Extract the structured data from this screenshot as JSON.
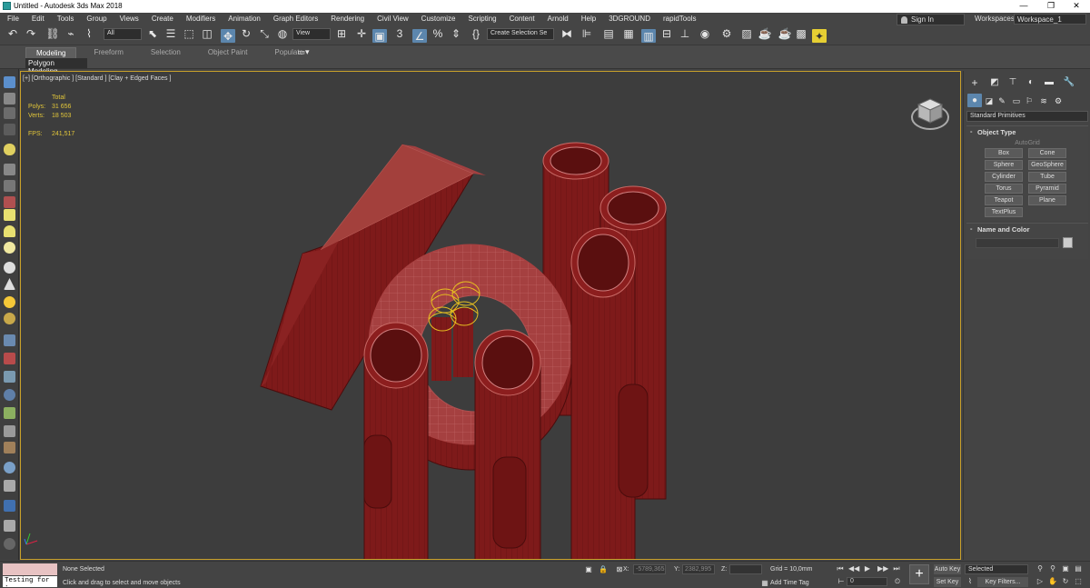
{
  "window": {
    "title": "Untitled - Autodesk 3ds Max 2018",
    "minimize": "—",
    "maximize": "❐",
    "close": "✕"
  },
  "menubar": {
    "items": [
      "File",
      "Edit",
      "Tools",
      "Group",
      "Views",
      "Create",
      "Modifiers",
      "Animation",
      "Graph Editors",
      "Rendering",
      "Civil View",
      "Customize",
      "Scripting",
      "Content",
      "Arnold",
      "Help",
      "3DGROUND",
      "rapidTools"
    ],
    "sign_in": "Sign In",
    "workspaces_label": "Workspaces:",
    "workspace_value": "Workspace_1"
  },
  "toolbar": {
    "selection_filter": "All",
    "ref_coord": "View",
    "named_selection": "Create Selection Se"
  },
  "ribbon": {
    "tabs": [
      "Modeling",
      "Freeform",
      "Selection",
      "Object Paint",
      "Populate"
    ],
    "active_tab": "Modeling",
    "sub_panel": "Polygon Modeling"
  },
  "viewport": {
    "label": "[+] [Orthographic ] [Standard ] [Clay + Edged Faces ]",
    "stats": {
      "header": "Total",
      "polys_label": "Polys:",
      "polys_value": "31 656",
      "verts_label": "Verts:",
      "verts_value": "18 503",
      "fps_label": "FPS:",
      "fps_value": "241,517"
    },
    "colors": {
      "mesh": "#8c1e1e",
      "mesh_light": "#a03a38",
      "wire": "#c86a66",
      "selection": "#e8c020",
      "border": "#c8a02a"
    }
  },
  "command_panel": {
    "category": "Standard Primitives",
    "object_type": {
      "header": "Object Type",
      "autogrid": "AutoGrid",
      "buttons": [
        "Box",
        "Cone",
        "Sphere",
        "GeoSphere",
        "Cylinder",
        "Tube",
        "Torus",
        "Pyramid",
        "Teapot",
        "Plane",
        "TextPlus"
      ]
    },
    "name_color": {
      "header": "Name and Color"
    }
  },
  "statusbar": {
    "script_listener": "Testing for :",
    "selection_status": "None Selected",
    "prompt": "Click and drag to select and move objects",
    "x_label": "X:",
    "x_value": "-5789,365",
    "y_label": "Y:",
    "y_value": "2382,995",
    "z_label": "Z:",
    "z_value": "",
    "grid": "Grid = 10,0mm",
    "add_time_tag": "Add Time Tag",
    "frame": "0",
    "auto_key": "Auto Key",
    "set_key": "Set Key",
    "selected": "Selected",
    "key_filters": "Key Filters..."
  }
}
